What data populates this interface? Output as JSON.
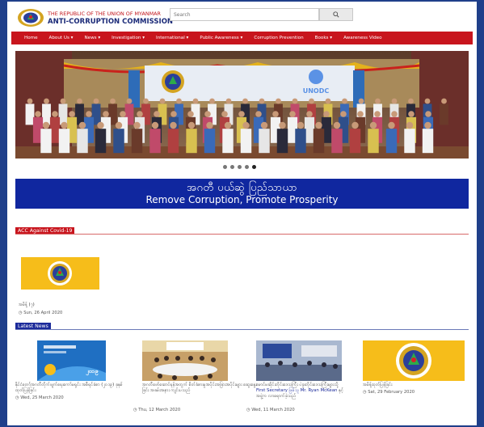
{
  "header": {
    "org_line": "THE REPUBLIC OF THE UNION OF MYANMAR",
    "org_name": "ANTI-CORRUPTION COMMISSION",
    "search_placeholder": "Search",
    "search_icon": "search-icon"
  },
  "nav": {
    "items": [
      {
        "label": "Home"
      },
      {
        "label": "About Us ▾"
      },
      {
        "label": "News ▾"
      },
      {
        "label": "Investigation ▾"
      },
      {
        "label": "International ▾"
      },
      {
        "label": "Public Awareness ▾"
      },
      {
        "label": "Corruption Prevention"
      },
      {
        "label": "Books ▾"
      },
      {
        "label": "Awareness Video"
      }
    ]
  },
  "hero": {
    "slide_count": 5,
    "active_slide": 5,
    "unodc_label": "UNODC"
  },
  "banner": {
    "myanmar_text": "အဂတီ ပယ်ဆွဲ ပြည်သာယာ",
    "english_text": "Remove Corruption, Promote Prosperity"
  },
  "covid": {
    "heading": "ACC Against Covid-19",
    "item": {
      "caption": "အမိန့် (၇)",
      "date": "Sun, 26 April 2020"
    }
  },
  "latest": {
    "heading": "Latest News",
    "items": [
      {
        "caption": "နိုင်ငံတော်အဂတီတိုက်ဖျက်ရေးကော်မရှင်း အစီရင်ခံစာ (၂၀၁၉) ခုနှစ် ထုတ်ပြန်ခြင်း",
        "date": "Wed, 25 March 2020",
        "thumb_text": "၂၀၁၉"
      },
      {
        "caption": "အဂတီဖော်ဆောင်ရန်အတွက် စိတ်ခံစားမှုအပိုင်းအခြားအပိုင်းများ ဆွေးနွေးခြင်း အခမ်းအနား ကျင်းပသည်",
        "date": "Thu, 12 March 2020"
      },
      {
        "caption_pre": "မောင်မဆိုင်းတိုင်းဒေသကြီး ပဲခူးတိုင်းဒေသကြီးများသို့ ",
        "caption_link": "First Secretary ဖြစ်သူ Mr. Ryan McKean",
        "caption_post": " နှင့်အဖွဲ့က လာရောက်ခဲ့သည်",
        "date": "Wed, 11 March 2020"
      },
      {
        "caption": "အမိန့်ထုတ်ပြန်ခြင်း",
        "date": "Sat, 29 February 2020"
      }
    ]
  },
  "colors": {
    "frame": "#1f3f8a",
    "nav_red": "#c8151d",
    "banner_blue": "#10279f",
    "brand_navy": "#1b2a78",
    "logo_yellow": "#f6bd1a"
  },
  "icons": {
    "clock": "clock-icon"
  }
}
